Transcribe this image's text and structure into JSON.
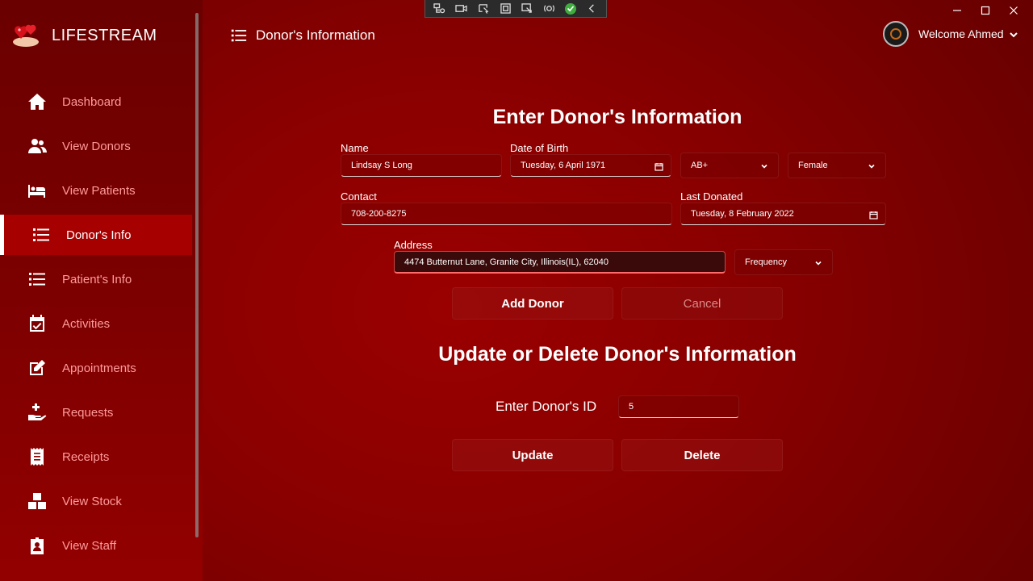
{
  "app": {
    "brand": "LIFESTREAM"
  },
  "header": {
    "title": "Donor's Information"
  },
  "user": {
    "welcome": "Welcome Ahmed"
  },
  "sidebar": {
    "items": [
      {
        "label": "Dashboard",
        "icon": "home-icon"
      },
      {
        "label": "View Donors",
        "icon": "users-icon"
      },
      {
        "label": "View Patients",
        "icon": "bed-icon"
      },
      {
        "label": "Donor's Info",
        "icon": "list-icon",
        "active": true
      },
      {
        "label": "Patient's Info",
        "icon": "list-icon"
      },
      {
        "label": "Activities",
        "icon": "calendar-check-icon"
      },
      {
        "label": "Appointments",
        "icon": "edit-icon"
      },
      {
        "label": "Requests",
        "icon": "hand-plus-icon"
      },
      {
        "label": "Receipts",
        "icon": "receipt-icon"
      },
      {
        "label": "View Stock",
        "icon": "boxes-icon"
      },
      {
        "label": "View Staff",
        "icon": "badge-icon"
      }
    ]
  },
  "form": {
    "heading": "Enter Donor's Information",
    "name_label": "Name",
    "name_value": "Lindsay S Long",
    "dob_label": "Date of Birth",
    "dob_value": "Tuesday, 6 April 1971",
    "blood_group": "AB+",
    "gender": "Female",
    "contact_label": "Contact",
    "contact_value": "708-200-8275",
    "last_donated_label": "Last Donated",
    "last_donated_value": "Tuesday, 8 February 2022",
    "address_label": "Address",
    "address_value": "4474 Butternut Lane, Granite City, Illinois(IL), 62040",
    "frequency": "Frequency",
    "add_label": "Add Donor",
    "cancel_label": "Cancel"
  },
  "update": {
    "heading": "Update or Delete Donor's Information",
    "id_label": "Enter Donor's ID",
    "id_value": "5",
    "update_label": "Update",
    "delete_label": "Delete"
  },
  "colors": {
    "accent": "#a60000",
    "nav_text": "#ff9b9b",
    "background": "#8a0000"
  }
}
